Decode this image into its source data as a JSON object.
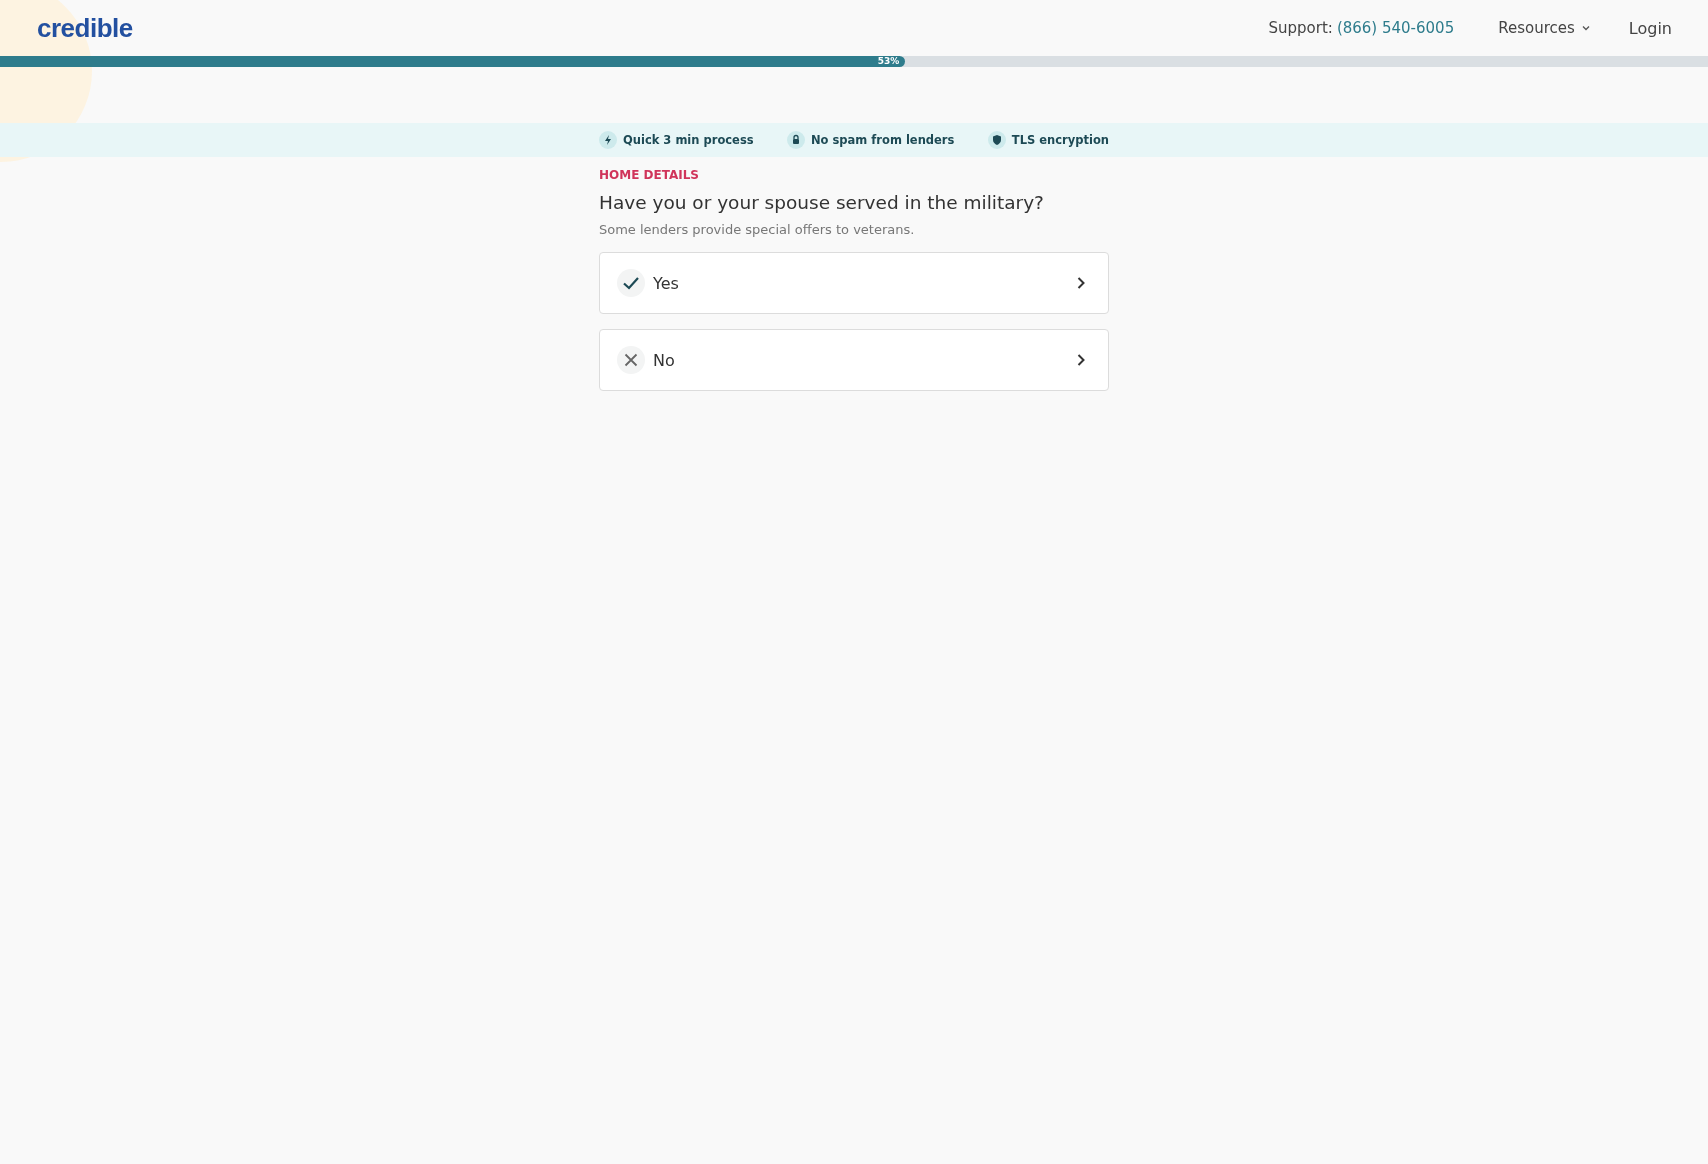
{
  "header": {
    "logo": "credible",
    "support_label": "Support:",
    "support_phone": "(866) 540-6005",
    "resources": "Resources",
    "login": "Login"
  },
  "progress": {
    "level": 0.53,
    "label": "53%"
  },
  "badges": [
    {
      "kind": "bolt",
      "text": "Quick 3 min process"
    },
    {
      "kind": "lock",
      "text": "No spam from lenders"
    },
    {
      "kind": "shield",
      "text": "TLS encryption"
    }
  ],
  "section": "HOME DETAILS",
  "question": "Have you or your spouse served in the military?",
  "hint": "Some lenders provide special offers to veterans.",
  "options": [
    {
      "kind": "yes",
      "label": "Yes"
    },
    {
      "kind": "no",
      "label": "No"
    }
  ]
}
